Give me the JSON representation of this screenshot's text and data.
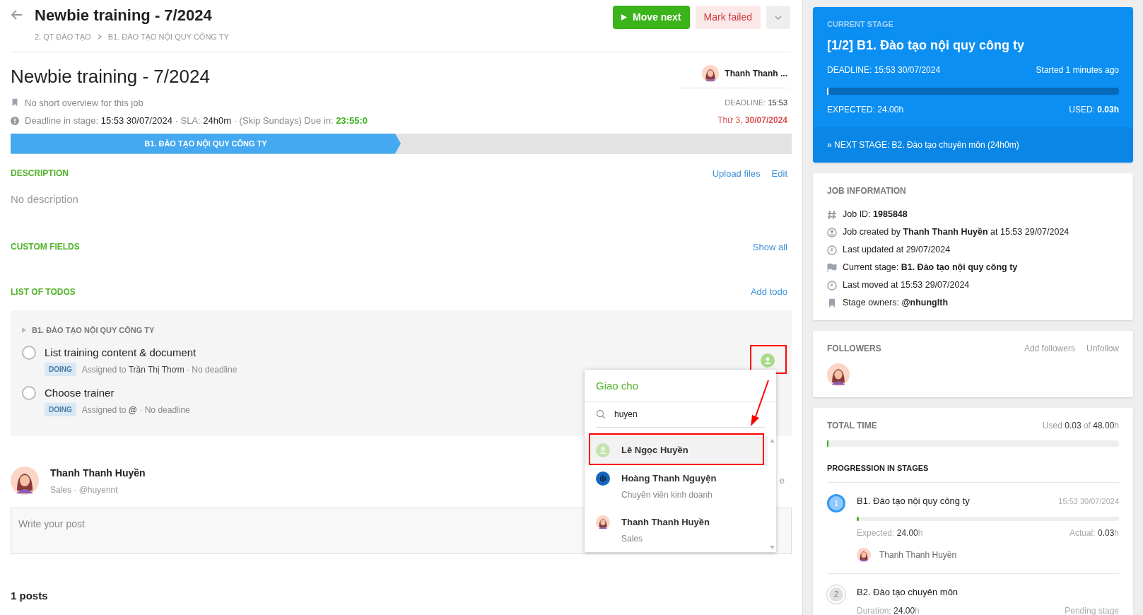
{
  "header": {
    "title": "Newbie training - 7/2024",
    "breadcrumb": [
      "2. QT ĐÀO TẠO",
      "B1. ĐÀO TẠO NỘI QUY CÔNG TY"
    ],
    "buttons": [
      {
        "kind": "primary",
        "label": "Move next"
      },
      {
        "kind": "danger",
        "label": "Mark failed"
      },
      {
        "kind": "menu"
      }
    ]
  },
  "job": {
    "title": "Newbie training - 7/2024",
    "overview": "No short overview for this job",
    "deadline_parts": [
      {
        "kind": "muted",
        "text": "Deadline in stage: "
      },
      {
        "kind": "value",
        "text": "15:53 30/07/2024"
      },
      {
        "kind": "muted",
        "text": " · SLA: "
      },
      {
        "kind": "value",
        "text": "24h0m"
      },
      {
        "kind": "muted",
        "text": " · (Skip Sundays) Due in: "
      },
      {
        "kind": "due",
        "text": "23:55:0"
      }
    ],
    "owner": "Thanh Thanh ...",
    "deadline_label": "DEADLINE:",
    "deadline_time": "15:53",
    "deadline_day": "Thứ 3,",
    "deadline_date": "30/07/2024"
  },
  "stages": [
    {
      "label": "B1. ĐÀO TẠO NỘI QUY CÔNG TY",
      "selected": true
    }
  ],
  "description": {
    "heading": "DESCRIPTION",
    "links": [
      "Upload files",
      "Edit"
    ],
    "text": "No description"
  },
  "custom_fields": {
    "heading": "CUSTOM FIELDS",
    "link": "Show all"
  },
  "todos": {
    "heading": "LIST OF TODOS",
    "link": "Add todo",
    "group": "B1. ĐÀO TẠO NỘI QUY CÔNG TY",
    "items": [
      {
        "title": "List training content & document",
        "checked": false,
        "status": "DOING",
        "assigned_label": "Assigned to",
        "assignee": "Trần Thị Thơm",
        "deadline": "· No deadline"
      },
      {
        "title": "Choose trainer",
        "checked": false,
        "status": "DOING",
        "assigned_label": "Assigned to",
        "assignee": "@",
        "deadline": "· No deadline"
      }
    ]
  },
  "assign_popup": {
    "title": "Giao cho",
    "search_value": "huyen",
    "options": [
      {
        "name": "Lê Ngọc Huyền",
        "kind": "placeholder",
        "selected": true
      },
      {
        "name": "Hoàng Thanh Nguyện",
        "subtitle": "Chuyên viên kinh doanh",
        "kind": "audio",
        "selected": false
      },
      {
        "name": "Thanh Thanh Huyền",
        "subtitle": "Sales",
        "kind": "person",
        "selected": false
      }
    ]
  },
  "composer": {
    "author": "Thanh Thanh Huyền",
    "author_meta": "Sales · @huyennt",
    "column_2": "e",
    "placeholder": "Write your post"
  },
  "posts_count": "1 posts",
  "current_stage": {
    "heading": "CURRENT STAGE",
    "title": "[1/2] B1. Đào tạo nội quy công ty",
    "deadline": "DEADLINE: 15:53 30/07/2024",
    "started": "Started 1 minutes ago",
    "level": 0.002,
    "expected": "EXPECTED: 24.00h",
    "used_label": "USED:",
    "used": "0.03h",
    "next": "» NEXT STAGE: B2. Đào tạo chuyên môn (24h0m)"
  },
  "job_information": {
    "heading": "JOB INFORMATION",
    "rows": [
      {
        "kind": "hash",
        "text": "Job ID: **1985848**"
      },
      {
        "kind": "user",
        "text": "Job created by **Thanh Thanh Huyền** at 15:53 29/07/2024"
      },
      {
        "kind": "clock",
        "text": "Last updated at 29/07/2024"
      },
      {
        "kind": "flag",
        "text": "Current stage: **B1. Đào tạo nội quy công ty**"
      },
      {
        "kind": "clock",
        "text": "Last moved at 15:53 29/07/2024"
      },
      {
        "kind": "bookmark",
        "text": "Stage owners: **@nhunglth**"
      }
    ]
  },
  "followers": {
    "heading": "FOLLOWERS",
    "links": [
      "Add followers",
      "Unfollow"
    ]
  },
  "total_time": {
    "heading": "TOTAL TIME",
    "used_label": "Used",
    "used": "0.03",
    "of_label": "of",
    "total": "48.00",
    "unit": "h",
    "level": 0.001,
    "progression_heading": "PROGRESSION IN STAGES",
    "stages": [
      {
        "number": "1",
        "selected": true,
        "name": "B1. Đào tạo nội quy công ty",
        "time": "15:53 30/07/2024",
        "level": 0.006,
        "left_label": "Expected:",
        "left_value": "24.00",
        "left_unit": "h",
        "right_label": "Actual:",
        "right_value": "0.03",
        "right_unit": "h",
        "person": "Thanh Thanh Huyền"
      },
      {
        "number": "2",
        "selected": false,
        "name": "B2. Đào tạo chuyên môn",
        "left_label": "Duration:",
        "left_value": "24.00",
        "left_unit": "h",
        "status": "Pending stage"
      }
    ]
  }
}
